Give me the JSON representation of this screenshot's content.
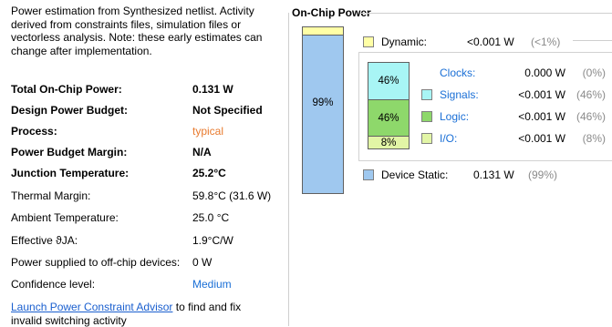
{
  "summary": {
    "intro": "Power estimation from Synthesized netlist. Activity derived from constraints files, simulation files or vectorless analysis. Note: these early estimates can change after implementation.",
    "rows": [
      {
        "label": "Total On-Chip Power:",
        "value": "0.131 W",
        "bold": true
      },
      {
        "label": "Design Power Budget:",
        "value": "Not Specified",
        "bold": true
      },
      {
        "label": "Process:",
        "value": "typical",
        "bold": true
      },
      {
        "label": "Power Budget Margin:",
        "value": "N/A",
        "bold": true
      },
      {
        "label": "Junction Temperature:",
        "value": "25.2°C",
        "bold": true
      },
      {
        "label": "Thermal Margin:",
        "value": "59.8°C (31.6 W)",
        "bold": false
      },
      {
        "label": "Ambient Temperature:",
        "value": "25.0 °C",
        "bold": false
      },
      {
        "label": "Effective ϑJA:",
        "value": "1.9°C/W",
        "bold": false
      },
      {
        "label": "Power supplied to off-chip devices:",
        "value": "0 W",
        "bold": false
      },
      {
        "label": "Confidence level:",
        "value": "Medium",
        "bold": false
      }
    ],
    "link_text": "Launch Power Constraint Advisor",
    "link_suffix": " to find and fix",
    "link_line2": "invalid switching activity"
  },
  "on_chip": {
    "title": "On-Chip Power",
    "main_bar_label": "99%",
    "dynamic": {
      "label": "Dynamic:",
      "value": "<0.001 W",
      "pct": "(<1%)"
    },
    "breakdown": {
      "segments": [
        {
          "pct_label": "46%"
        },
        {
          "pct_label": "46%"
        },
        {
          "pct_label": "8%"
        }
      ],
      "items": [
        {
          "name": "Clocks:",
          "value": "0.000 W",
          "pct": "(0%)"
        },
        {
          "name": "Signals:",
          "value": "<0.001 W",
          "pct": "(46%)"
        },
        {
          "name": "Logic:",
          "value": "<0.001 W",
          "pct": "(46%)"
        },
        {
          "name": "I/O:",
          "value": "<0.001 W",
          "pct": "(8%)"
        }
      ]
    },
    "static": {
      "label": "Device Static:",
      "value": "0.131 W",
      "pct": "(99%)"
    }
  },
  "colors": {
    "dynamic": "#ffffa6",
    "static": "#9fc8ef",
    "signals": "#a8f5f5",
    "logic": "#8ed86b",
    "io": "#e2f5a6",
    "process": "#e87a2e",
    "link": "#1a5fcf"
  }
}
